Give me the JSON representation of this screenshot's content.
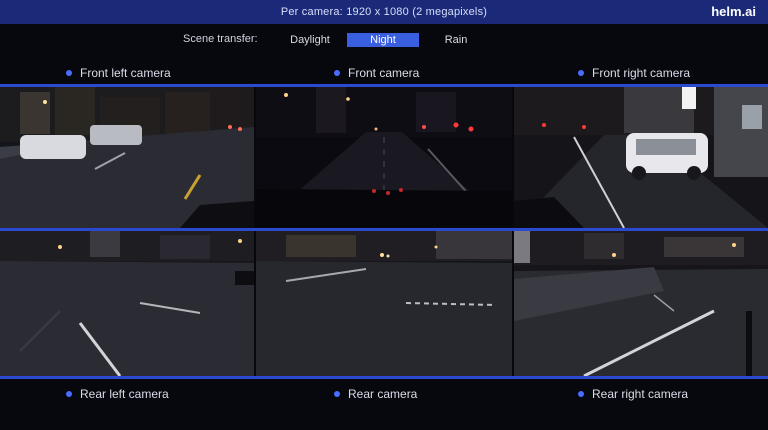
{
  "header": {
    "title": "Per camera: 1920 x 1080 (2 megapixels)",
    "brand": "helm.ai"
  },
  "scene_transfer": {
    "label": "Scene transfer:",
    "options": [
      "Daylight",
      "Night",
      "Rain"
    ],
    "selected": "Night"
  },
  "cameras": {
    "front": [
      "Front left camera",
      "Front camera",
      "Front right camera"
    ],
    "rear": [
      "Rear left camera",
      "Rear camera",
      "Rear right camera"
    ]
  },
  "colors": {
    "accent": "#3a5ee0",
    "header_bg": "#1a2a78",
    "rule": "#2c4ad0"
  }
}
